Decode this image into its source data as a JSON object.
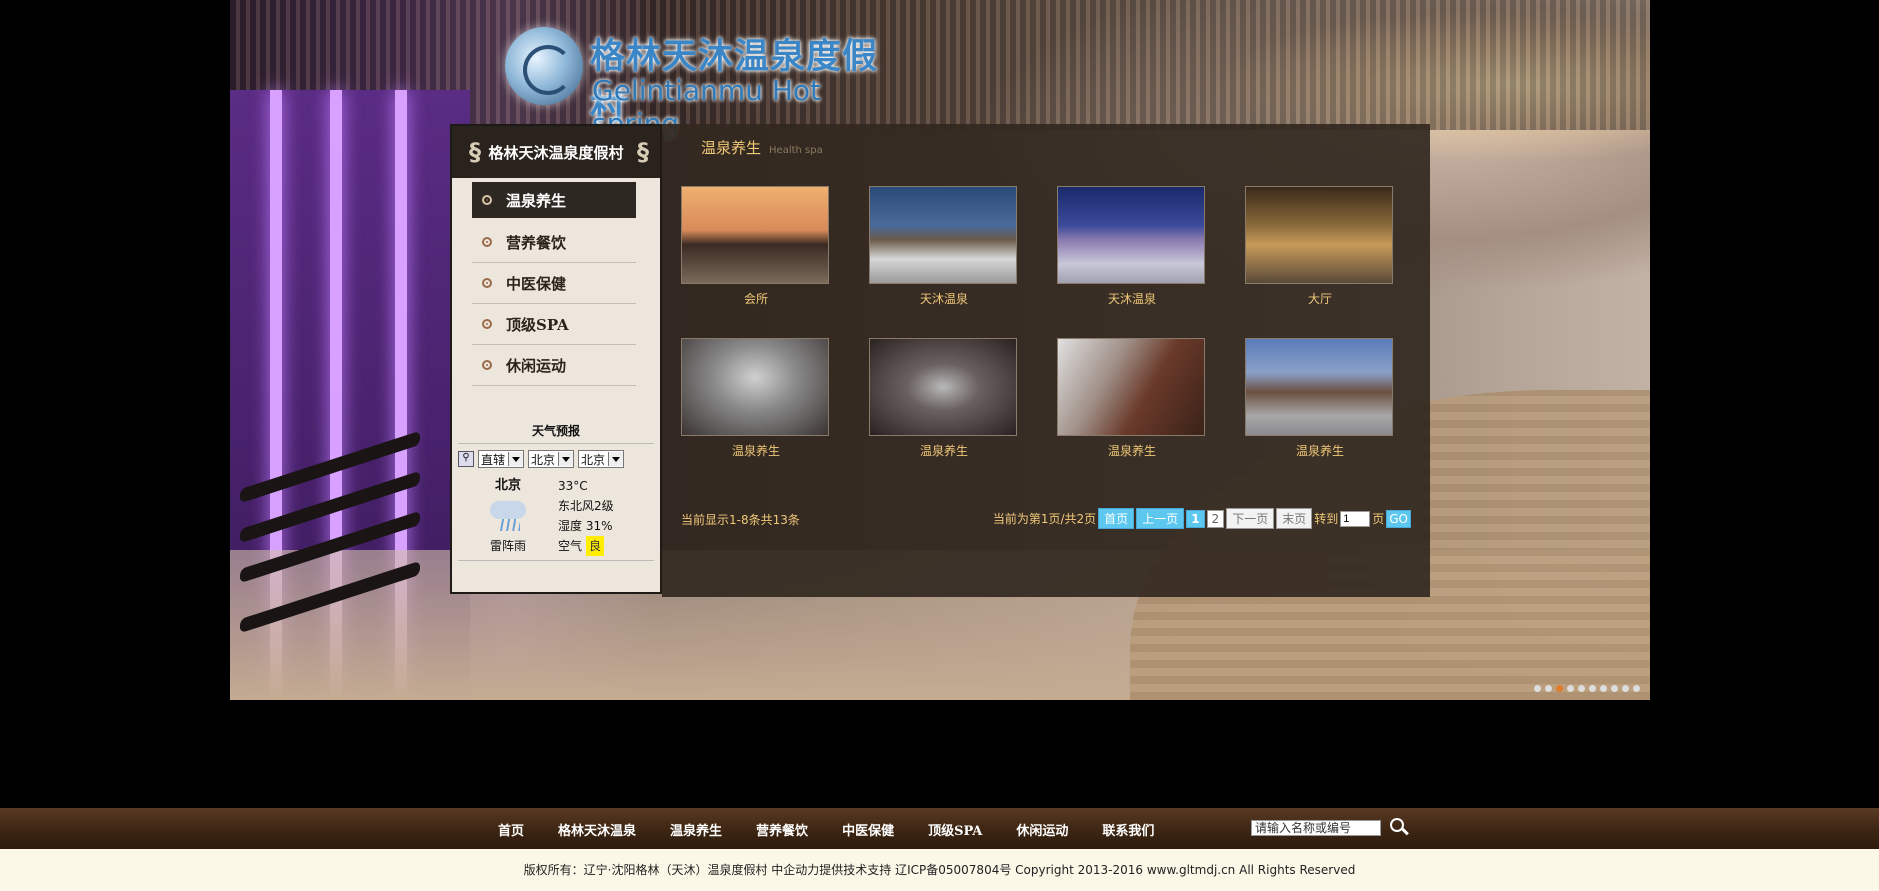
{
  "logo": {
    "cn": "格林天沐温泉度假村",
    "en": "Gelintianmu Hot spring"
  },
  "sidebar": {
    "title": "格林天沐温泉度假村",
    "items": [
      {
        "label": "温泉养生"
      },
      {
        "label": "营养餐饮"
      },
      {
        "label": "中医保健"
      },
      {
        "label": "顶级SPA"
      },
      {
        "label": "休闲运动"
      }
    ]
  },
  "weather": {
    "title": "天气预报",
    "select1": "直辖",
    "select2": "北京",
    "select3": "北京",
    "city": "北京",
    "condition": "雷阵雨",
    "temp": "33°C",
    "wind": "东北风2级",
    "humidity": "湿度 31%",
    "air_label": "空气",
    "air_value": "良"
  },
  "content": {
    "title": "温泉养生",
    "subtitle": "Health spa",
    "items": [
      {
        "caption": "会所"
      },
      {
        "caption": "天沐温泉"
      },
      {
        "caption": "天沐温泉"
      },
      {
        "caption": "大厅"
      },
      {
        "caption": "温泉养生"
      },
      {
        "caption": "温泉养生"
      },
      {
        "caption": "温泉养生"
      },
      {
        "caption": "温泉养生"
      }
    ],
    "pager_info": "当前显示1-8条共13条",
    "pager": {
      "current": "当前为第1页/共2页",
      "first": "首页",
      "prev": "上一页",
      "page1": "1",
      "page2": "2",
      "next": "下一页",
      "last": "末页",
      "goto": "转到",
      "goto_value": "1",
      "page_unit": "页",
      "go": "GO"
    }
  },
  "nav": {
    "links": [
      "首页",
      "格林天沐温泉",
      "温泉养生",
      "营养餐饮",
      "中医保健",
      "顶级SPA",
      "休闲运动",
      "联系我们"
    ],
    "search_value": "请输入名称或编号"
  },
  "footer": {
    "text": "版权所有：辽宁·沈阳格林（天沐）温泉度假村  中企动力提供技术支持  辽ICP备05007804号  Copyright 2013-2016   www.gltmdj.cn  All Rights Reserved"
  },
  "slider": {
    "active_index": 2,
    "count": 10
  }
}
